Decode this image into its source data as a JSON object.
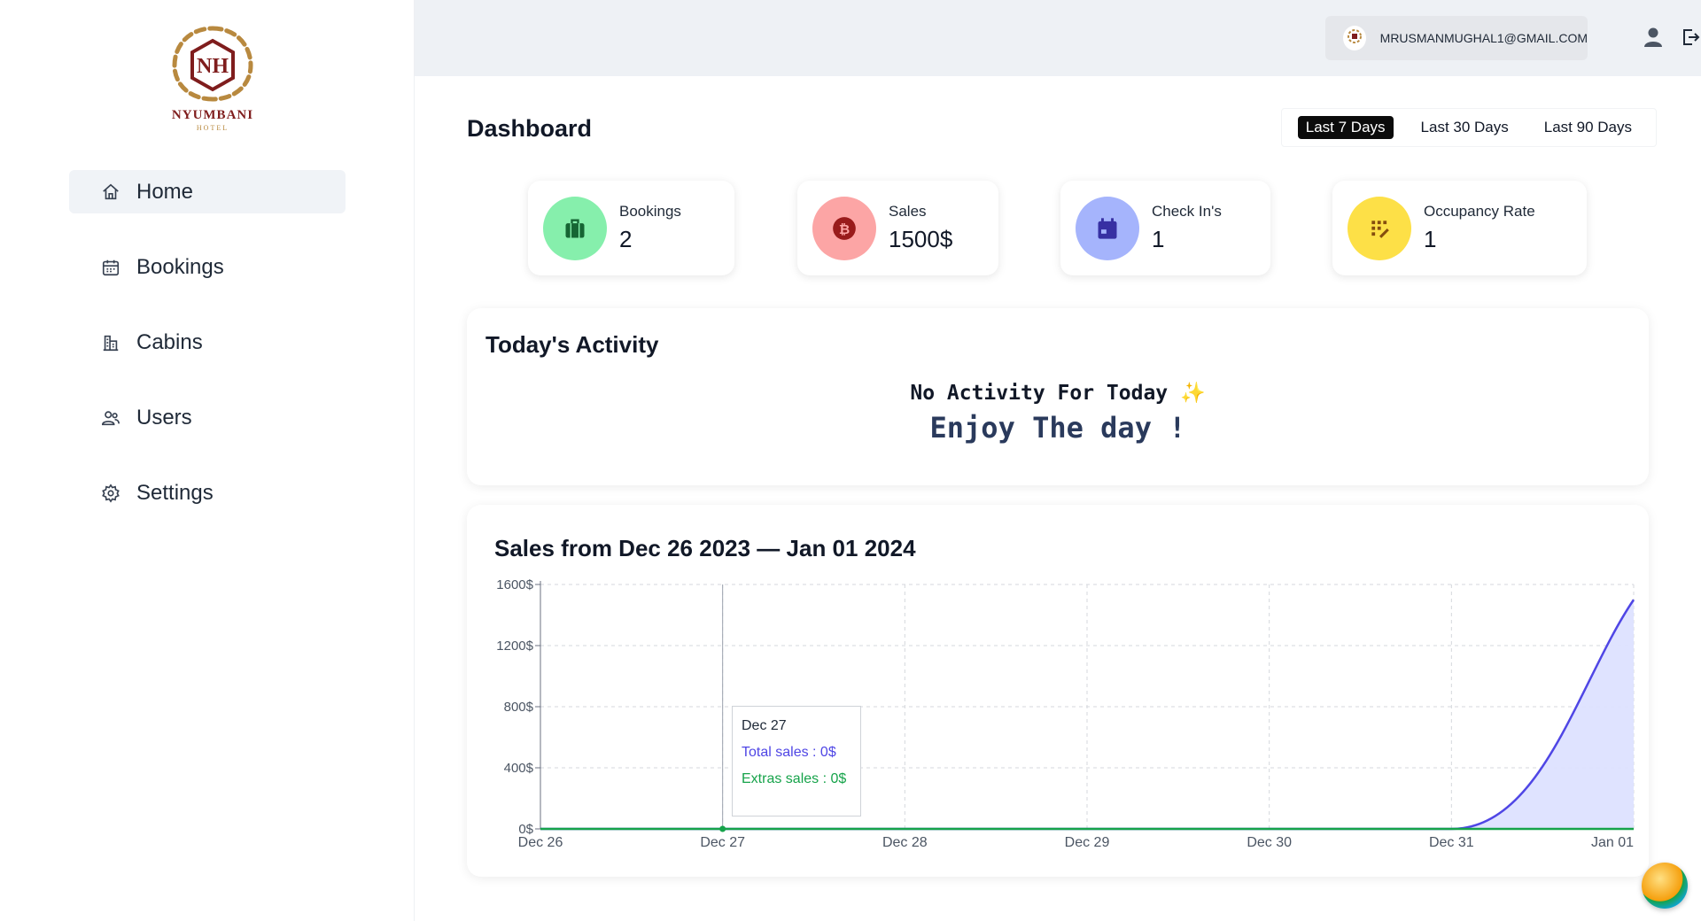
{
  "brand": {
    "name": "NYUMBANI",
    "sub": "HOTEL",
    "monogram": "NH"
  },
  "sidebar": {
    "items": [
      {
        "label": "Home",
        "icon": "home-icon",
        "active": true
      },
      {
        "label": "Bookings",
        "icon": "calendar-icon",
        "active": false
      },
      {
        "label": "Cabins",
        "icon": "building-icon",
        "active": false
      },
      {
        "label": "Users",
        "icon": "users-icon",
        "active": false
      },
      {
        "label": "Settings",
        "icon": "gear-icon",
        "active": false
      }
    ]
  },
  "header": {
    "user_email": "MRUSMANMUGHAL1@GMAIL.COM",
    "icons": [
      "user-icon",
      "logout-icon"
    ]
  },
  "dashboard": {
    "title": "Dashboard",
    "filters": [
      {
        "label": "Last 7 Days",
        "active": true
      },
      {
        "label": "Last 30 Days",
        "active": false
      },
      {
        "label": "Last 90 Days",
        "active": false
      }
    ],
    "stats": [
      {
        "label": "Bookings",
        "value": "2",
        "icon": "briefcase-icon",
        "color": "#86efac",
        "icon_color": "#166534"
      },
      {
        "label": "Sales",
        "value": "1500$",
        "icon": "coin-icon",
        "color": "#fca5a5",
        "icon_color": "#991b1b"
      },
      {
        "label": "Check In's",
        "value": "1",
        "icon": "calendar-icon",
        "color": "#a5b4fc",
        "icon_color": "#3730a3"
      },
      {
        "label": "Occupancy Rate",
        "value": "1",
        "icon": "chart-icon",
        "color": "#fde047",
        "icon_color": "#854d0e"
      }
    ]
  },
  "activity": {
    "title": "Today's Activity",
    "empty_line1": "No Activity For Today",
    "empty_emoji": "✨",
    "empty_line2": "Enjoy The day !"
  },
  "chart_data": {
    "type": "area",
    "title": "Sales from Dec 26 2023 — Jan 01 2024",
    "categories": [
      "Dec 26",
      "Dec 27",
      "Dec 28",
      "Dec 29",
      "Dec 30",
      "Dec 31",
      "Jan 01"
    ],
    "series": [
      {
        "name": "Total sales",
        "values": [
          0,
          0,
          0,
          0,
          0,
          0,
          1500
        ],
        "color": "#4f46e5",
        "fill": "#dde2ff"
      },
      {
        "name": "Extras sales",
        "values": [
          0,
          0,
          0,
          0,
          0,
          0,
          0
        ],
        "color": "#16a34a"
      }
    ],
    "ylim": [
      0,
      1600
    ],
    "yticks": [
      "0$",
      "400$",
      "800$",
      "1200$",
      "1600$"
    ],
    "ytick_values": [
      0,
      400,
      800,
      1200,
      1600
    ],
    "grid": true,
    "tooltip": {
      "date": "Dec 27",
      "total": "Total sales : 0$",
      "extras": "Extras sales : 0$"
    }
  }
}
